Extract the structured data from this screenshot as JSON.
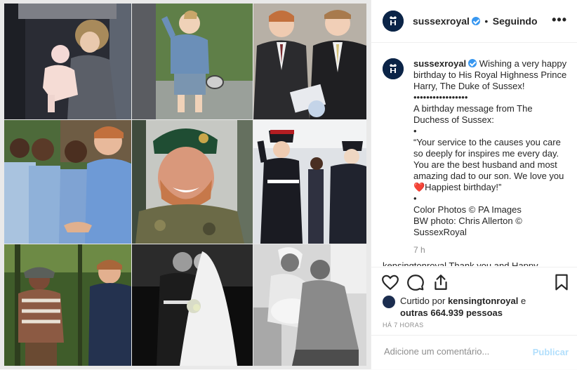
{
  "post": {
    "username": "sussexroyal",
    "follow_separator": "•",
    "follow_label": "Seguindo",
    "more_label": "•••",
    "caption_lines": [
      "Wishing a very happy birthday to His Royal Highness Prince Harry, The Duke of Sussex!",
      "•••••••••••••••••",
      "A birthday message from The Duchess of Sussex:",
      "•",
      "“Your service to the causes you care so deeply for inspires me every day. You are the best husband and most amazing dad to our son. We love you ❤️Happiest birthday!”",
      "•",
      "Color Photos © PA Images",
      "BW photo: Chris Allerton © SussexRoyal"
    ],
    "time_ago": "7 h",
    "next_comment_preview": "kensingtonroyal Thank you and Happy",
    "liked_by_prefix": "Curtido por",
    "liked_by_user": "kensingtonroyal",
    "liked_by_suffix": "e",
    "others_text": "outras 664.939 pessoas",
    "posted_time": "HÁ 7 HORAS",
    "comment_placeholder": "Adicione um comentário...",
    "publish_label": "Publicar"
  },
  "icons": {
    "like": "heart-icon",
    "comment": "comment-icon",
    "share": "share-icon",
    "save": "bookmark-icon",
    "more": "more-options-icon",
    "verified": "verified-badge-icon"
  },
  "colors": {
    "avatar_bg": "#0b2447",
    "verified": "#3897f0",
    "publish_disabled": "#b2dffc",
    "muted_text": "#8e8e8e"
  }
}
